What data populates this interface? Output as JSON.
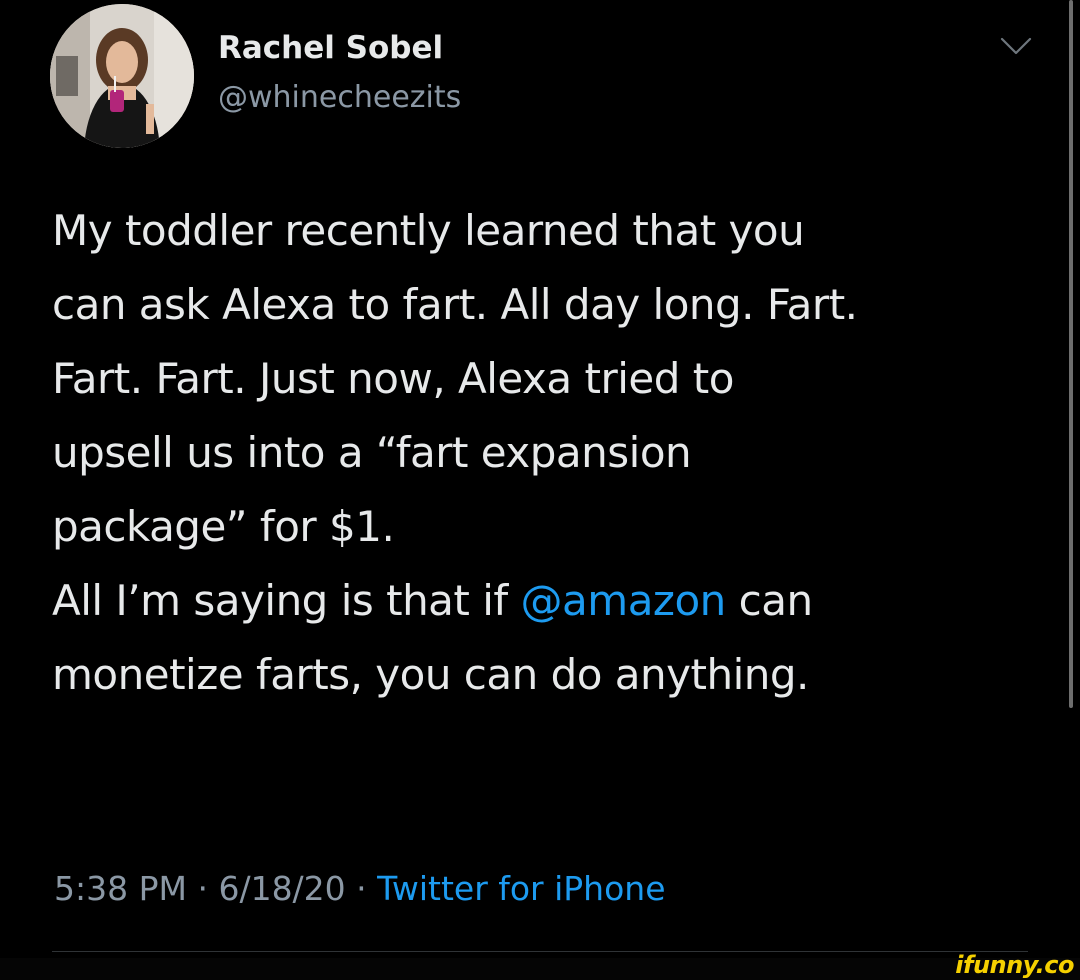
{
  "tweet": {
    "author": {
      "display_name": "Rachel Sobel",
      "handle": "@whinecheezits",
      "avatar_icon": "profile-photo"
    },
    "menu_icon": "chevron-down-icon",
    "paragraphs": [
      {
        "lines": [
          "My toddler recently learned that you",
          "can ask Alexa to fart. All day long. Fart.",
          "Fart. Fart. Just now, Alexa tried to",
          "upsell us into a “fart expansion",
          "package” for $1."
        ]
      },
      {
        "line1_before": "All I’m saying is that if ",
        "mention": "@amazon",
        "line1_after": " can",
        "line2": "monetize farts, you can do anything."
      }
    ],
    "time": "5:38 PM",
    "separator1": " · ",
    "date": "6/18/20",
    "separator2": " · ",
    "source": "Twitter for iPhone"
  },
  "watermark": "ifunny.co",
  "colors": {
    "background": "#000000",
    "text": "#e7e9ea",
    "muted": "#8b98a5",
    "link": "#1d9bf0",
    "watermark": "#f5d000"
  }
}
